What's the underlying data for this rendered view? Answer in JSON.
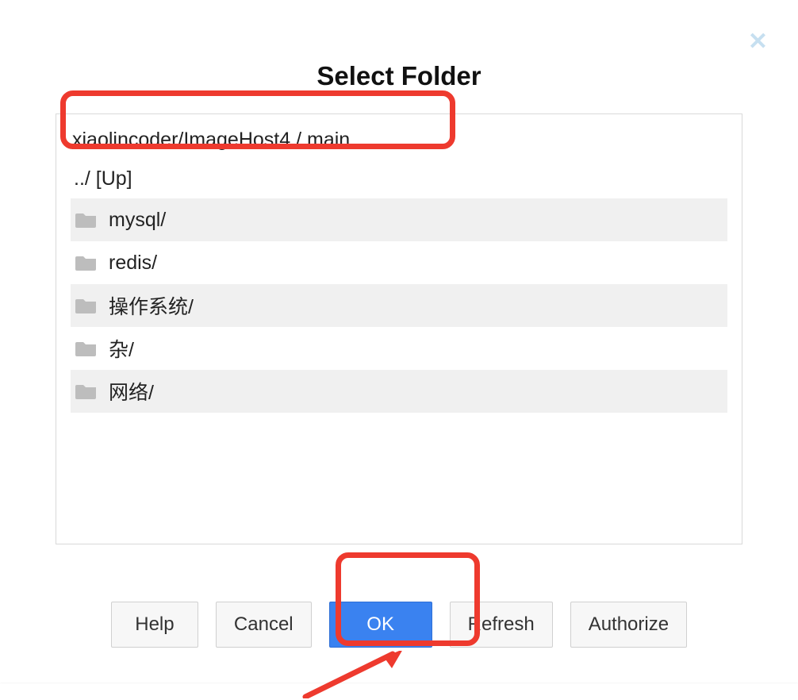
{
  "title": "Select Folder",
  "breadcrumb": {
    "repo": "xiaolincoder/ImageHost4",
    "sep": " / ",
    "branch": "main"
  },
  "up_label": "../ [Up]",
  "folders": [
    {
      "name": "mysql/"
    },
    {
      "name": "redis/"
    },
    {
      "name": "操作系统/"
    },
    {
      "name": "杂/"
    },
    {
      "name": "网络/"
    }
  ],
  "buttons": {
    "help": "Help",
    "cancel": "Cancel",
    "ok": "OK",
    "refresh": "Refresh",
    "authorize": "Authorize"
  },
  "colors": {
    "highlight": "#ee3a2e",
    "primary": "#3a82f0",
    "close": "#c6dff0"
  }
}
